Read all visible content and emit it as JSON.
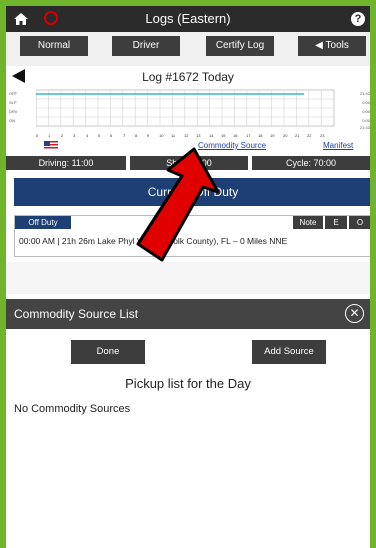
{
  "app": {
    "title": "Logs (Eastern)"
  },
  "toolbar": {
    "normal": "Normal",
    "driver": "Driver",
    "certify": "Certify Log",
    "tools": "Tools"
  },
  "log": {
    "title": "Log #1672 Today"
  },
  "graph": {
    "row_labels": [
      "OFF",
      "SLP",
      "DRV",
      "ON"
    ],
    "totals": [
      "21:43",
      "0:00",
      "0:00",
      "0:00",
      "21:43"
    ],
    "hours": [
      "0",
      "1",
      "2",
      "3",
      "4",
      "5",
      "6",
      "7",
      "8",
      "9",
      "10",
      "11",
      "12",
      "13",
      "14",
      "15",
      "16",
      "17",
      "18",
      "19",
      "20",
      "21",
      "22",
      "23"
    ]
  },
  "links": {
    "commodity_source": "Commodity Source",
    "manifest": "Manifest"
  },
  "stats": {
    "driving": "Driving: 11:00",
    "shift": "Shift: 14:00",
    "cycle": "Cycle: 70:00"
  },
  "status": {
    "current": "Current: Off Duty"
  },
  "event": {
    "type": "Off Duty",
    "note": "Note",
    "edit": "E",
    "other": "O",
    "line": "00:00 AM | 21h 26m    Lake Phyl Village (Polk County), FL – 0 Miles NNE"
  },
  "commodity_panel": {
    "title": "Commodity Source List",
    "done": "Done",
    "add_source": "Add Source",
    "pickup_title": "Pickup list for the Day",
    "empty_message": "No Commodity Sources"
  },
  "colors": {
    "frame_green": "#6fb52c",
    "status_blue": "#1d3f73",
    "arrow_red": "#e00000"
  }
}
